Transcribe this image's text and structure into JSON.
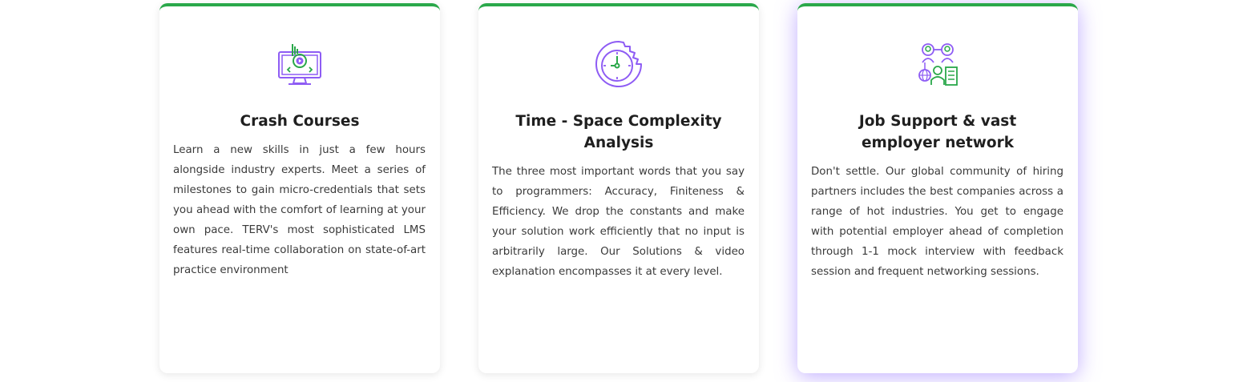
{
  "colors": {
    "accent_green": "#2aa84a",
    "icon_purple": "#8e5cf4",
    "title_text": "#1f1f1f",
    "body_text": "#3a3a3a",
    "highlight_glow": "#8e6cff"
  },
  "cards": [
    {
      "icon": "monitor-play-icon",
      "title": "Crash Courses",
      "description": "Learn a new skills in just a few hours alongside industry experts. Meet a series of milestones to gain micro-credentials that sets you ahead with the comfort of learning at your own pace. TERV's most sophisticated LMS features real-time collaboration on state-of-art practice environment"
    },
    {
      "icon": "clock-gear-icon",
      "title": "Time - Space Complexity Analysis",
      "description": "The three most important words that you say to programmers: Accuracy, Finiteness & Efficiency. We drop the constants and make your solution work efficiently that no input is arbitrarily large. Our Solutions & video explanation encompasses it at every level."
    },
    {
      "icon": "people-network-icon",
      "title": "Job Support & vast employer network",
      "description": "Don't settle. Our global community of hiring partners includes the best companies across a range of hot industries. You get to engage with potential employer ahead of completion through 1-1 mock interview with feedback session and frequent networking sessions."
    }
  ]
}
